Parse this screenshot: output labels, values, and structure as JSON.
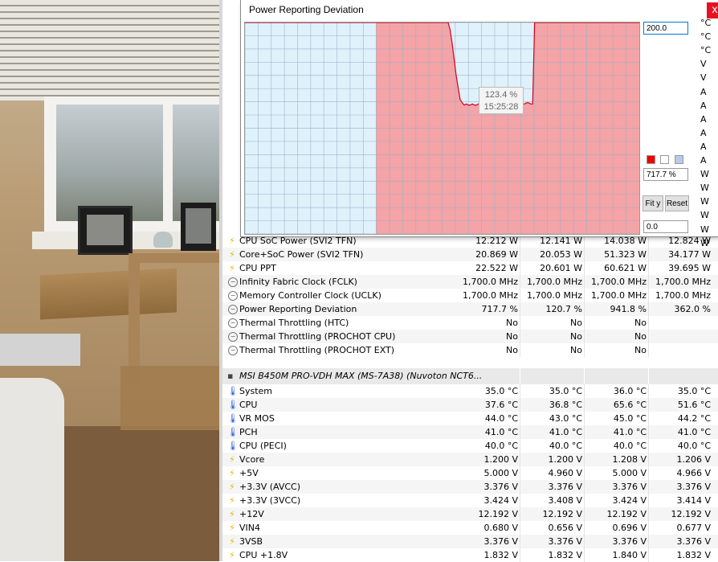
{
  "graph": {
    "title": "Power Reporting Deviation",
    "close_label": "x",
    "max_value": "200.0",
    "min_value": "0.0",
    "current_value": "717.7 %",
    "fit_label": "Fit y",
    "reset_label": "Reset",
    "tooltip_value": "123.4 %",
    "tooltip_time": "15:25:28",
    "colors": {
      "over": "#f4a3a6",
      "under": "#dff1fb",
      "line": "#d2001f",
      "grid": "#9bb0c8"
    }
  },
  "chart_data": {
    "type": "line",
    "title": "Power Reporting Deviation",
    "ylim": [
      0,
      200
    ],
    "series": [
      {
        "values": [
          200,
          200,
          200,
          200,
          200,
          200,
          200,
          200,
          200,
          200,
          200,
          200,
          200,
          200,
          200,
          200,
          200,
          200,
          200,
          200,
          200,
          200,
          200,
          200,
          200,
          200,
          200,
          200,
          200,
          200,
          200,
          200,
          200,
          200,
          200,
          200,
          200,
          200,
          200,
          200,
          200,
          200,
          200,
          200,
          200,
          200,
          200,
          200,
          200,
          200,
          200,
          200,
          200,
          200,
          200,
          200,
          200,
          200,
          200,
          200,
          200,
          200,
          200,
          200,
          200,
          200,
          200,
          200,
          200,
          200,
          200,
          200,
          200,
          200,
          200,
          200,
          200,
          200,
          200,
          200,
          200,
          200,
          200,
          200,
          200,
          200,
          200,
          200,
          200,
          200,
          200,
          200,
          200,
          200,
          200,
          200,
          200,
          200,
          200,
          200,
          200,
          200,
          193,
          180,
          165,
          150,
          138,
          127,
          124,
          122,
          123,
          122,
          122,
          123,
          122,
          122,
          123,
          123,
          122,
          123,
          122,
          123,
          122,
          124,
          123,
          123,
          122,
          122,
          123,
          123,
          123,
          123,
          124,
          123,
          123,
          123,
          123,
          122,
          123,
          123,
          124,
          124,
          123,
          123,
          200,
          200,
          200,
          200,
          200,
          200,
          200,
          200,
          200,
          200,
          200,
          200,
          200,
          200,
          200,
          200,
          200,
          200,
          200,
          200,
          200,
          200,
          200,
          200,
          200,
          200,
          200,
          200,
          200,
          200,
          200,
          200,
          200,
          200,
          200,
          200,
          200,
          200,
          200,
          200,
          200,
          200,
          200,
          200,
          200,
          200,
          200,
          200,
          200,
          200,
          200,
          200,
          200
        ]
      }
    ]
  },
  "hidden_units": [
    "°C",
    "°C",
    "°C",
    "V",
    "V",
    "A",
    "A",
    "A",
    "A",
    "A",
    "A",
    "W",
    "W",
    "W",
    "W",
    "W",
    "W"
  ],
  "rows_top": [
    {
      "icon": "bolt",
      "label": "CPU SoC Power (SVI2 TFN)",
      "v": [
        "12.212 W",
        "12.141 W",
        "14.038 W",
        "12.824 W"
      ]
    },
    {
      "icon": "bolt",
      "label": "Core+SoC Power (SVI2 TFN)",
      "v": [
        "20.869 W",
        "20.053 W",
        "51.323 W",
        "34.177 W"
      ]
    },
    {
      "icon": "bolt",
      "label": "CPU PPT",
      "v": [
        "22.522 W",
        "20.601 W",
        "60.621 W",
        "39.695 W"
      ]
    },
    {
      "icon": "clock",
      "label": "Infinity Fabric Clock (FCLK)",
      "v": [
        "1,700.0 MHz",
        "1,700.0 MHz",
        "1,700.0 MHz",
        "1,700.0 MHz"
      ]
    },
    {
      "icon": "clock",
      "label": "Memory Controller Clock (UCLK)",
      "v": [
        "1,700.0 MHz",
        "1,700.0 MHz",
        "1,700.0 MHz",
        "1,700.0 MHz"
      ]
    },
    {
      "icon": "clock",
      "label": "Power Reporting Deviation",
      "v": [
        "717.7 %",
        "120.7 %",
        "941.8 %",
        "362.0 %"
      ]
    },
    {
      "icon": "clock",
      "label": "Thermal Throttling (HTC)",
      "v": [
        "No",
        "No",
        "No",
        ""
      ]
    },
    {
      "icon": "clock",
      "label": "Thermal Throttling (PROCHOT CPU)",
      "v": [
        "No",
        "No",
        "No",
        ""
      ]
    },
    {
      "icon": "clock",
      "label": "Thermal Throttling (PROCHOT EXT)",
      "v": [
        "No",
        "No",
        "No",
        ""
      ]
    }
  ],
  "group": {
    "label": "MSI B450M PRO-VDH MAX (MS-7A38) (Nuvoton NCT6..."
  },
  "rows_bottom": [
    {
      "icon": "therm",
      "label": "System",
      "v": [
        "35.0 °C",
        "35.0 °C",
        "36.0 °C",
        "35.0 °C"
      ]
    },
    {
      "icon": "therm",
      "label": "CPU",
      "v": [
        "37.6 °C",
        "36.8 °C",
        "65.6 °C",
        "51.6 °C"
      ]
    },
    {
      "icon": "therm",
      "label": "VR MOS",
      "v": [
        "44.0 °C",
        "43.0 °C",
        "45.0 °C",
        "44.2 °C"
      ]
    },
    {
      "icon": "therm",
      "label": "PCH",
      "v": [
        "41.0 °C",
        "41.0 °C",
        "41.0 °C",
        "41.0 °C"
      ]
    },
    {
      "icon": "therm",
      "label": "CPU (PECI)",
      "v": [
        "40.0 °C",
        "40.0 °C",
        "40.0 °C",
        "40.0 °C"
      ]
    },
    {
      "icon": "bolt",
      "label": "Vcore",
      "v": [
        "1.200 V",
        "1.200 V",
        "1.208 V",
        "1.206 V"
      ]
    },
    {
      "icon": "bolt",
      "label": "+5V",
      "v": [
        "5.000 V",
        "4.960 V",
        "5.000 V",
        "4.966 V"
      ]
    },
    {
      "icon": "bolt",
      "label": "+3.3V (AVCC)",
      "v": [
        "3.376 V",
        "3.376 V",
        "3.376 V",
        "3.376 V"
      ]
    },
    {
      "icon": "bolt",
      "label": "+3.3V (3VCC)",
      "v": [
        "3.424 V",
        "3.408 V",
        "3.424 V",
        "3.414 V"
      ]
    },
    {
      "icon": "bolt",
      "label": "+12V",
      "v": [
        "12.192 V",
        "12.192 V",
        "12.192 V",
        "12.192 V"
      ]
    },
    {
      "icon": "bolt",
      "label": "VIN4",
      "v": [
        "0.680 V",
        "0.656 V",
        "0.696 V",
        "0.677 V"
      ]
    },
    {
      "icon": "bolt",
      "label": "3VSB",
      "v": [
        "3.376 V",
        "3.376 V",
        "3.376 V",
        "3.376 V"
      ]
    },
    {
      "icon": "bolt",
      "label": "CPU +1.8V",
      "v": [
        "1.832 V",
        "1.832 V",
        "1.840 V",
        "1.832 V"
      ]
    }
  ]
}
